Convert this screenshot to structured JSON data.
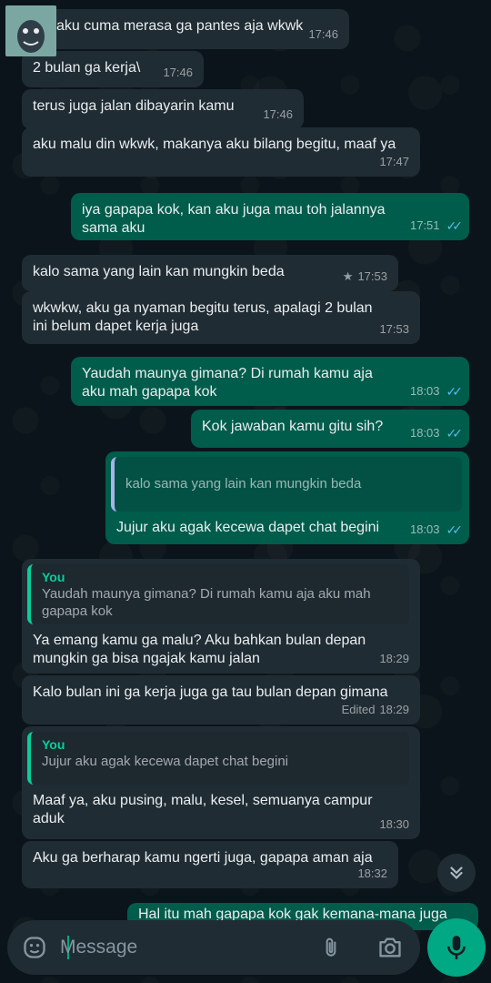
{
  "messages": [
    {
      "text": "aku cuma merasa ga pantes aja wkwk",
      "time": "17:46"
    },
    {
      "text": "2 bulan ga kerja\\",
      "time": "17:46"
    },
    {
      "text": "terus juga jalan dibayarin kamu",
      "time": "17:46"
    },
    {
      "text": "aku malu din wkwk, makanya aku bilang begitu, maaf ya",
      "time": "17:47"
    },
    {
      "text": "iya gapapa kok, kan aku juga mau toh jalannya sama aku",
      "time": "17:51"
    },
    {
      "text": "kalo sama yang lain kan mungkin beda",
      "time": "17:53"
    },
    {
      "text": "wkwkw, aku ga nyaman begitu terus, apalagi 2 bulan ini belum dapet kerja juga",
      "time": "17:53"
    },
    {
      "text": "Yaudah maunya gimana? Di rumah kamu aja aku mah gapapa kok",
      "time": "18:03"
    },
    {
      "text": "Kok jawaban kamu gitu sih?",
      "time": "18:03"
    },
    {
      "quote": "kalo sama yang lain kan mungkin beda",
      "text": "Jujur aku agak kecewa dapet chat begini",
      "time": "18:03"
    },
    {
      "quote_author": "You",
      "quote": "Yaudah maunya gimana? Di rumah kamu aja aku mah gapapa kok",
      "text": "Ya emang kamu ga malu? Aku bahkan bulan depan mungkin ga bisa ngajak kamu jalan",
      "time": "18:29"
    },
    {
      "text": "Kalo bulan ini ga kerja juga ga tau bulan depan gimana",
      "edited": "Edited",
      "time": "18:29"
    },
    {
      "quote_author": "You",
      "quote": "Jujur aku agak kecewa dapet chat begini",
      "text": "Maaf ya, aku pusing, malu, kesel, semuanya campur aduk",
      "time": "18:30"
    },
    {
      "text": "Aku ga berharap kamu ngerti juga, gapapa aman aja",
      "time": "18:32"
    },
    {
      "text": "Hal itu mah gapapa kok gak kemana-mana juga"
    }
  ],
  "composer": {
    "placeholder": "Message"
  },
  "colors": {
    "background": "#0b141a",
    "incoming_bubble": "#202c33",
    "outgoing_bubble": "#005c4b",
    "read_ticks": "#53bdeb",
    "accent": "#00a884"
  },
  "icons": [
    "emoji-icon",
    "attach-icon",
    "camera-icon",
    "mic-icon",
    "chevron-double-down-icon",
    "double-check-icon",
    "star-icon"
  ]
}
